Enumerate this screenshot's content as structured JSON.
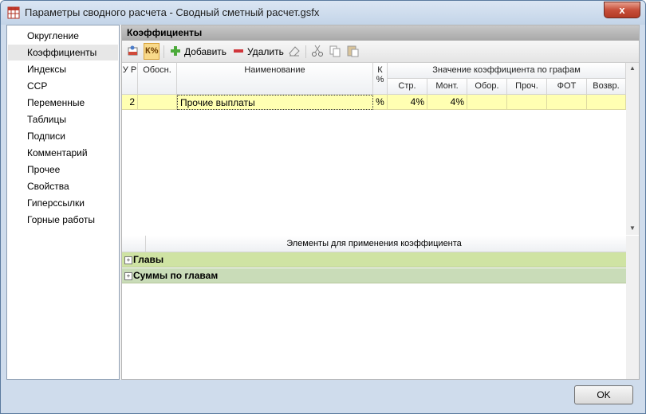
{
  "window": {
    "title": "Параметры сводного расчета - Сводный сметный расчет.gsfx",
    "close_label": "x"
  },
  "nav": {
    "items": [
      {
        "label": "Округление"
      },
      {
        "label": "Коэффициенты",
        "active": true
      },
      {
        "label": "Индексы"
      },
      {
        "label": "ССР"
      },
      {
        "label": "Переменные"
      },
      {
        "label": "Таблицы"
      },
      {
        "label": "Подписи"
      },
      {
        "label": "Комментарий"
      },
      {
        "label": "Прочее"
      },
      {
        "label": "Свойства"
      },
      {
        "label": "Гиперссылки"
      },
      {
        "label": "Горные работы"
      }
    ]
  },
  "section": {
    "title": "Коэффициенты"
  },
  "toolbar": {
    "add_label": "Добавить",
    "delete_label": "Удалить",
    "k_percent_label": "К%",
    "icons": [
      "edit-icon",
      "percent-coefficient-icon",
      "add-icon",
      "remove-icon",
      "eraser-icon",
      "cut-icon",
      "copy-icon",
      "paste-icon"
    ]
  },
  "table": {
    "headers": {
      "level": "У Р",
      "justification": "Обосн.",
      "name": "Наименование",
      "percent": "К %",
      "group_title": "Значение коэффициента по графам",
      "columns": [
        "Стр.",
        "Монт.",
        "Обор.",
        "Проч.",
        "ФОТ",
        "Возвр."
      ]
    },
    "rows": [
      {
        "level": "2",
        "justification": "",
        "name": "Прочие выплаты",
        "percent": "%",
        "values": [
          "4%",
          "4%",
          "",
          "",
          "",
          ""
        ]
      }
    ]
  },
  "elements": {
    "header": "Элементы для применения коэффициента",
    "groups": [
      {
        "label": "Главы",
        "color": "#cfe3a3"
      },
      {
        "label": "Суммы по главам",
        "color": "#c9dcb8"
      }
    ]
  },
  "footer": {
    "ok_label": "OK"
  },
  "colors": {
    "row_highlight": "#ffffb2",
    "close_button": "#c74f3a"
  }
}
